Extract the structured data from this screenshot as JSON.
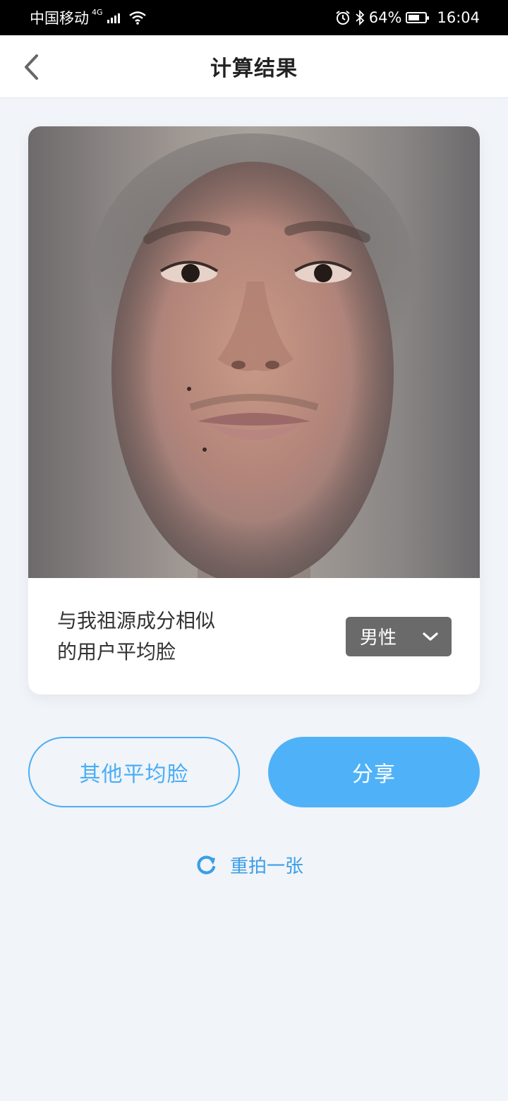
{
  "status_bar": {
    "carrier": "中国移动",
    "network": "4G",
    "battery": "64%",
    "battery_level": 0.64,
    "time": "16:04"
  },
  "header": {
    "title": "计算结果",
    "back_icon": "chevron-left-icon"
  },
  "result_card": {
    "image_desc_icon": "average-face-photo",
    "text_line1": "与我祖源成分相似",
    "text_line2": "的用户平均脸",
    "gender_select": {
      "selected": "男性",
      "icon": "chevron-down-icon"
    }
  },
  "actions": {
    "other_faces_label": "其他平均脸",
    "share_label": "分享",
    "retake_label": "重拍一张",
    "retake_icon": "refresh-icon"
  },
  "colors": {
    "accent": "#4fb2f8",
    "background": "#f1f4f8",
    "select_bg": "#6a6a6a"
  }
}
